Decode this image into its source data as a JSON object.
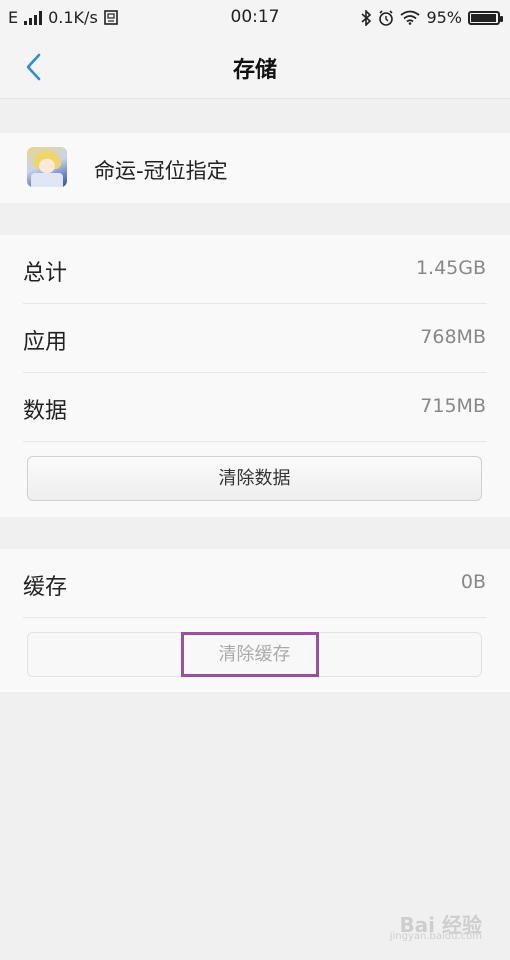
{
  "status_bar": {
    "network": "E",
    "speed": "0.1K/s",
    "time": "00:17",
    "battery": "95%",
    "battery_level": 0.95
  },
  "nav": {
    "title": "存储"
  },
  "app": {
    "name": "命运-冠位指定"
  },
  "storage": {
    "rows": [
      {
        "label": "总计",
        "value": "1.45GB"
      },
      {
        "label": "应用",
        "value": "768MB"
      },
      {
        "label": "数据",
        "value": "715MB"
      }
    ],
    "clear_data_label": "清除数据"
  },
  "cache": {
    "label": "缓存",
    "value": "0B",
    "clear_cache_label": "清除缓存"
  },
  "watermark": {
    "text": "Bai 经验",
    "sub": "jingyan.baidu.com"
  },
  "colors": {
    "accent": "#2b8fd8",
    "highlight": "#9a4fa0"
  }
}
